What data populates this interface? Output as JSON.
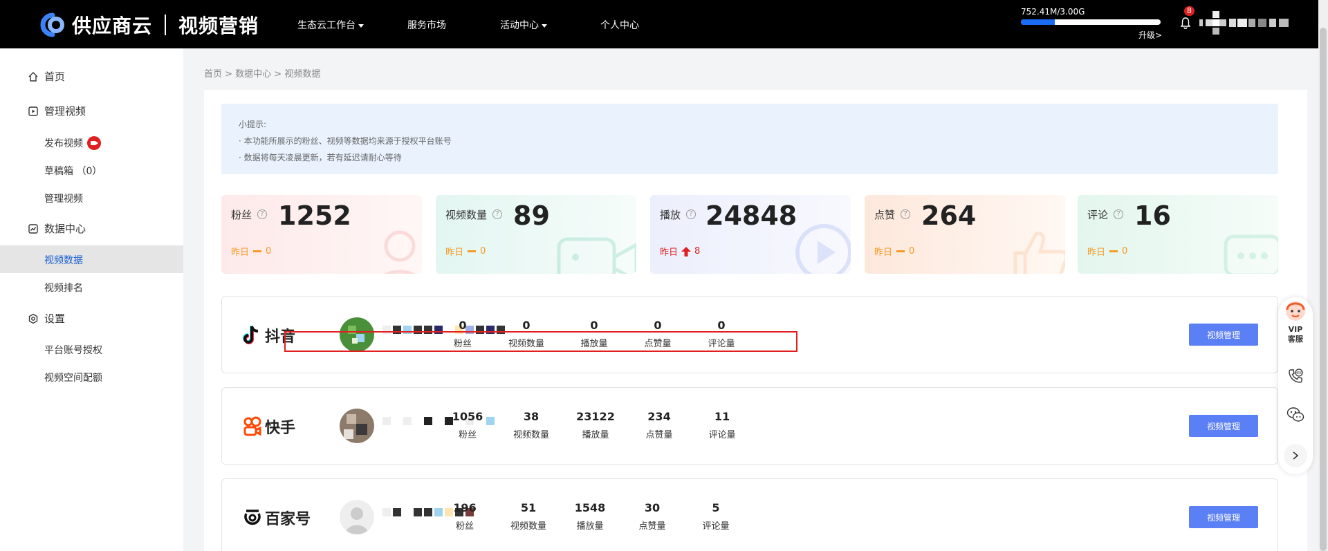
{
  "header": {
    "brand": "供应商云",
    "product": "视频营销",
    "nav": [
      {
        "label": "生态云工作台",
        "dropdown": true
      },
      {
        "label": "服务市场",
        "dropdown": false
      },
      {
        "label": "活动中心",
        "dropdown": true
      },
      {
        "label": "个人中心",
        "dropdown": false
      }
    ],
    "storage": {
      "text": "752.41M/3.00G",
      "used_fraction": 0.245,
      "upgrade": "升级>"
    },
    "notification_count": "8"
  },
  "sidebar": {
    "home": "首页",
    "manage_group": "管理视频",
    "publish": "发布视频",
    "drafts": "草稿箱 （0）",
    "manage": "管理视频",
    "data_group": "数据中心",
    "video_data": "视频数据",
    "video_rank": "视频排名",
    "settings_group": "设置",
    "platform_auth": "平台账号授权",
    "space_quota": "视频空间配额"
  },
  "breadcrumb": "首页 > 数据中心 > 视频数据",
  "tip": {
    "title": "小提示:",
    "line1": "· 本功能所展示的粉丝、视频等数据均来源于授权平台账号",
    "line2": "· 数据将每天凌晨更新，若有延迟请耐心等待"
  },
  "stats": [
    {
      "label": "粉丝",
      "value": "1252",
      "yesterday": "昨日",
      "delta": "0",
      "trend": "flat",
      "color": "#fdeeee"
    },
    {
      "label": "视频数量",
      "value": "89",
      "yesterday": "昨日",
      "delta": "0",
      "trend": "flat",
      "color": "#e8f7f3"
    },
    {
      "label": "播放",
      "value": "24848",
      "yesterday": "昨日",
      "delta": "8",
      "trend": "up",
      "color": "#eef1fc"
    },
    {
      "label": "点赞",
      "value": "264",
      "yesterday": "昨日",
      "delta": "0",
      "trend": "flat",
      "color": "#fdf1e8"
    },
    {
      "label": "评论",
      "value": "16",
      "yesterday": "昨日",
      "delta": "0",
      "trend": "flat",
      "color": "#e9f7f1"
    }
  ],
  "platforms": [
    {
      "name": "抖音",
      "icon": "douyin-icon",
      "metrics": [
        "0",
        "0",
        "0",
        "0",
        "0"
      ],
      "labels": [
        "粉丝",
        "视频数量",
        "播放量",
        "点赞量",
        "评论量"
      ],
      "button": "视频管理"
    },
    {
      "name": "快手",
      "icon": "kuaishou-icon",
      "metrics": [
        "1056",
        "38",
        "23122",
        "234",
        "11"
      ],
      "labels": [
        "粉丝",
        "视频数量",
        "播放量",
        "点赞量",
        "评论量"
      ],
      "button": "视频管理"
    },
    {
      "name": "百家号",
      "icon": "baijiahao-icon",
      "metrics": [
        "196",
        "51",
        "1548",
        "30",
        "5"
      ],
      "labels": [
        "粉丝",
        "视频数量",
        "播放量",
        "点赞量",
        "评论量"
      ],
      "button": "视频管理"
    }
  ],
  "float": {
    "vip_line1": "VIP",
    "vip_line2": "客服"
  }
}
